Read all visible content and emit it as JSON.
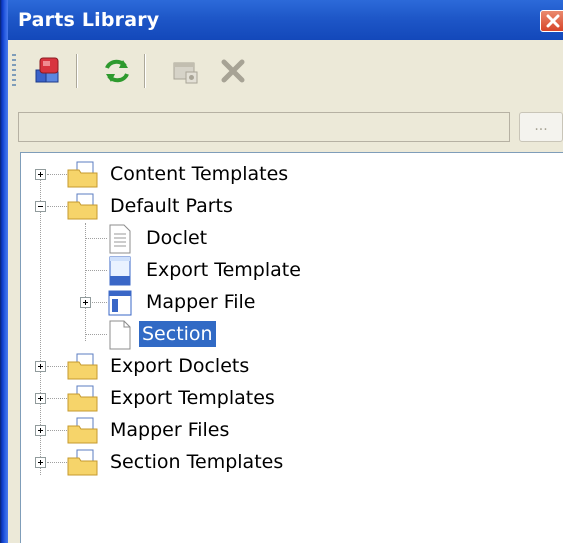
{
  "window": {
    "title": "Parts Library"
  },
  "toolbar": {
    "buttons": [
      {
        "name": "add-part",
        "icon": "colored-blocks-icon"
      },
      {
        "name": "refresh",
        "icon": "refresh-icon"
      },
      {
        "name": "new-folder",
        "icon": "folder-add-icon"
      },
      {
        "name": "delete",
        "icon": "delete-x-icon"
      }
    ]
  },
  "search": {
    "value": "",
    "browse_label": "..."
  },
  "tree": {
    "items": [
      {
        "label": "Content Templates",
        "expanded": false
      },
      {
        "label": "Default Parts",
        "expanded": true,
        "children": [
          {
            "label": "Doclet"
          },
          {
            "label": "Export Template"
          },
          {
            "label": "Mapper File",
            "expanded": false
          },
          {
            "label": "Section",
            "selected": true
          }
        ]
      },
      {
        "label": "Export Doclets",
        "expanded": false
      },
      {
        "label": "Export Templates",
        "expanded": false
      },
      {
        "label": "Mapper Files",
        "expanded": false
      },
      {
        "label": "Section Templates",
        "expanded": false
      }
    ]
  }
}
